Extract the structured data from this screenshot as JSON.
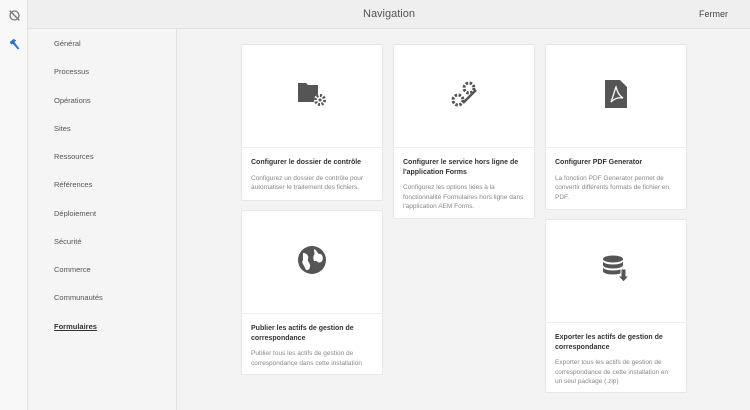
{
  "header": {
    "title": "Navigation",
    "close_label": "Fermer"
  },
  "rail": {
    "icons": [
      "compass-off-icon",
      "hammer-icon"
    ],
    "accent": "#2d6ed3"
  },
  "nav": {
    "items": [
      "Général",
      "Processus",
      "Opérations",
      "Sites",
      "Ressources",
      "Références",
      "Déploiement",
      "Sécurité",
      "Commerce",
      "Communautés",
      "Formulaires"
    ],
    "active": "Formulaires"
  },
  "cards": [
    {
      "title": "Configurer le dossier de contrôle",
      "desc": "Configurez un dossier de contrôle pour automatiser le traitement des fichiers.",
      "icon": "folder-gear-icon"
    },
    {
      "title": "Configurer le service hors ligne de l'application Forms",
      "desc": "Configurez les options liées à la fonctionnalité Formulaires hors ligne dans l'application AEM Forms.",
      "icon": "gears-icon"
    },
    {
      "title": "Configurer PDF Generator",
      "desc": "La fonction PDF Generator permet de convertir différents formats de fichier en PDF.",
      "icon": "pdf-file-icon"
    },
    {
      "title": "Publier les actifs de gestion de correspondance",
      "desc": "Publier tous les actifs de gestion de correspondance dans cette installation",
      "icon": "globe-icon"
    },
    {
      "title": "Exporter les actifs de gestion de correspondance",
      "desc": "Exporter tous les actifs de gestion de correspondance de cette installation en un seul package (.zip)",
      "icon": "database-download-icon"
    }
  ]
}
